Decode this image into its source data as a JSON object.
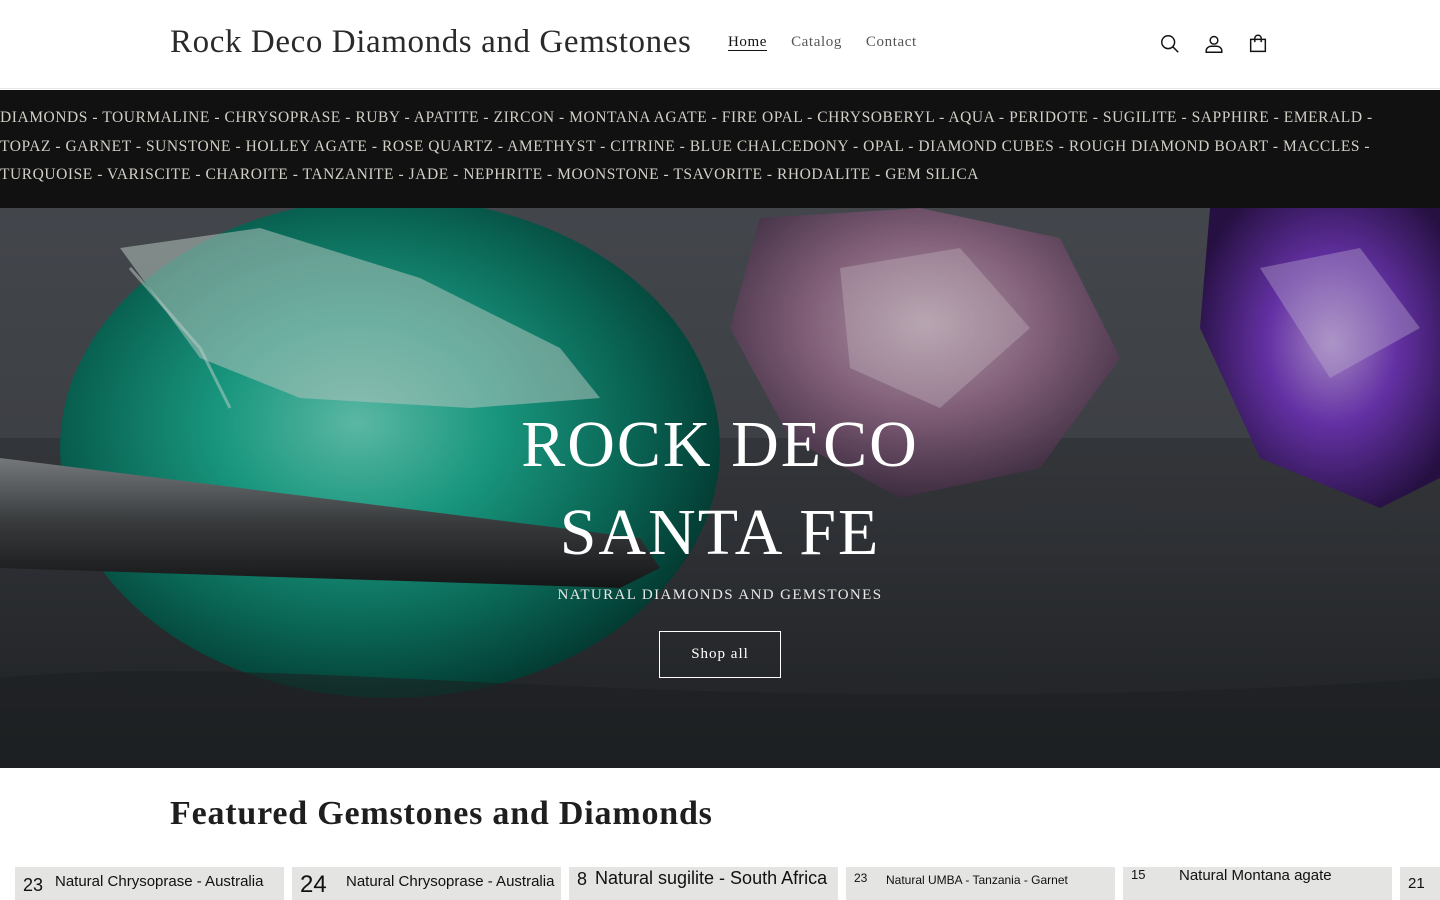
{
  "header": {
    "logo": "Rock Deco Diamonds and Gemstones",
    "nav": [
      {
        "label": "Home",
        "active": true
      },
      {
        "label": "Catalog",
        "active": false
      },
      {
        "label": "Contact",
        "active": false
      }
    ],
    "icons": [
      "search-icon",
      "account-icon",
      "cart-icon"
    ]
  },
  "gem_bar": {
    "lines": [
      "DIAMONDS - TOURMALINE - CHRYSOPRASE - RUBY - APATITE - ZIRCON - MONTANA AGATE - FIRE OPAL - CHRYSOBERYL - AQUA - PERIDOTE - SUGILITE - SAPPHIRE - EMERALD -",
      "TOPAZ - GARNET - SUNSTONE - HOLLEY AGATE - ROSE QUARTZ - AMETHYST - CITRINE - BLUE CHALCEDONY - OPAL - DIAMOND CUBES - ROUGH DIAMOND BOART - MACCLES -",
      "TURQUOISE - VARISCITE - CHAROITE - TANZANITE - JADE - NEPHRITE - MOONSTONE - TSAVORITE - RHODALITE - GEM SILICA"
    ]
  },
  "hero": {
    "title_line1": "ROCK DECO",
    "title_line2": "SANTA FE",
    "subtitle": "NATURAL DIAMONDS AND GEMSTONES",
    "button": "Shop all"
  },
  "featured": {
    "title": "Featured Gemstones and Diamonds",
    "cards": [
      {
        "num": "23",
        "text": "Natural Chrysoprase - Australia"
      },
      {
        "num": "24",
        "text": "Natural Chrysoprase - Australia"
      },
      {
        "num": "8",
        "text": "Natural sugilite - South Africa"
      },
      {
        "num": "23",
        "text": "Natural UMBA - Tanzania - Garnet"
      },
      {
        "num": "15",
        "text": "Natural Montana agate"
      },
      {
        "num": "21",
        "text": ""
      }
    ]
  },
  "colors": {
    "gem_bar_bg": "#111111",
    "gem_bar_text": "#d2cfc7",
    "hero_text": "#ffffff"
  }
}
